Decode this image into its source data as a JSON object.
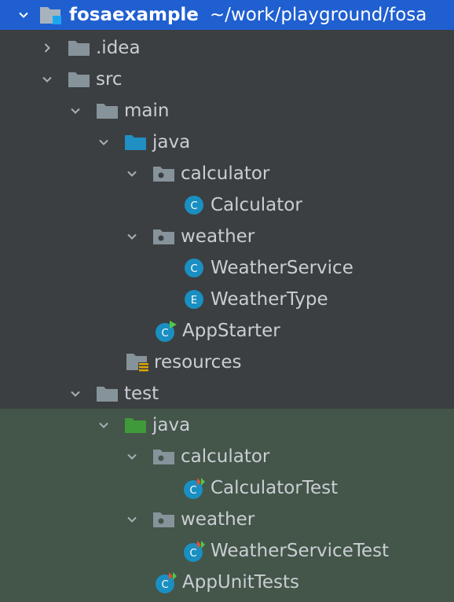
{
  "root": {
    "name": "fosaexample",
    "path": "~/work/playground/fosa"
  },
  "items": [
    {
      "label": ".idea"
    },
    {
      "label": "src"
    },
    {
      "label": "main"
    },
    {
      "label": "java"
    },
    {
      "label": "calculator"
    },
    {
      "label": "Calculator"
    },
    {
      "label": "weather"
    },
    {
      "label": "WeatherService"
    },
    {
      "label": "WeatherType"
    },
    {
      "label": "AppStarter"
    },
    {
      "label": "resources"
    },
    {
      "label": "test"
    },
    {
      "label": "java"
    },
    {
      "label": "calculator"
    },
    {
      "label": "CalculatorTest"
    },
    {
      "label": "weather"
    },
    {
      "label": "WeatherServiceTest"
    },
    {
      "label": "AppUnitTests"
    }
  ],
  "colors": {
    "selection": "#1f5fd0",
    "background": "#3b3f41",
    "test_background": "#44554a",
    "folder": "#87939a",
    "source_folder": "#1f8fc4",
    "test_folder": "#3f9a3a",
    "class_icon": "#1a8fc1"
  },
  "icons": [
    "chevron-down-icon",
    "chevron-right-icon",
    "folder-icon",
    "source-folder-icon",
    "test-folder-icon",
    "package-icon",
    "class-icon",
    "enum-icon",
    "runnable-class-icon",
    "test-class-icon",
    "resources-folder-icon",
    "module-icon"
  ]
}
